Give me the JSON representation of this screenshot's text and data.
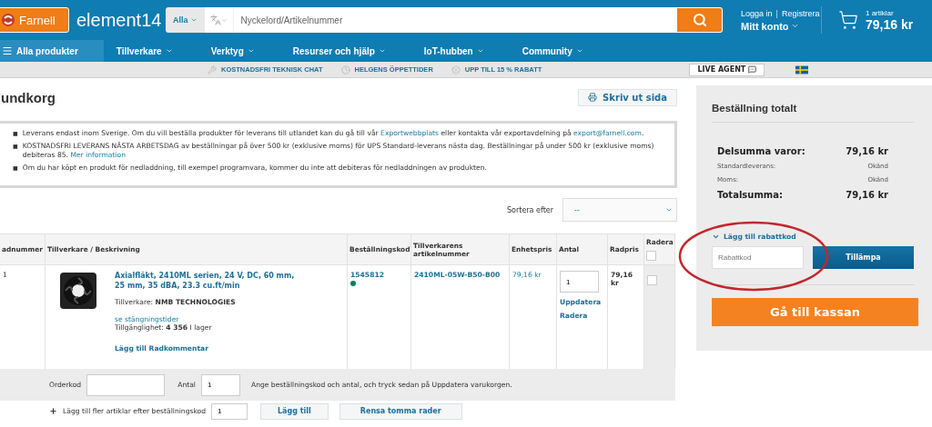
{
  "header": {
    "logo": "Farnell",
    "brand": "element14",
    "search": {
      "scope": "Alla",
      "placeholder": "Nyckelord/Artikelnummer"
    },
    "account": {
      "login": "Logga in",
      "separator": "|",
      "register": "Registrera",
      "label": "Mitt konto"
    },
    "cart": {
      "count": "1 artiklar",
      "total": "79,16 kr"
    }
  },
  "nav": [
    {
      "label": "Alla produkter",
      "selected": true,
      "menu": false
    },
    {
      "label": "Tillverkare",
      "selected": false,
      "menu": true
    },
    {
      "label": "Verktyg",
      "selected": false,
      "menu": true
    },
    {
      "label": "Resurser och hjälp",
      "selected": false,
      "menu": true
    },
    {
      "label": "IoT-hubben",
      "selected": false,
      "menu": true
    },
    {
      "label": "Community",
      "selected": false,
      "menu": true
    }
  ],
  "promo": {
    "items": [
      {
        "kind": "wrench",
        "label": "KOSTNADSFRI TEKNISK CHAT"
      },
      {
        "kind": "clock",
        "label": "HELGENS ÖPPETTIDER"
      },
      {
        "kind": "tag",
        "label": "UPP TILL 15 % RABATT"
      }
    ],
    "live_agent": "LIVE AGENT"
  },
  "page": {
    "title": "undkorg",
    "print_button": "Skriv ut sida"
  },
  "notices": [
    {
      "marker": "■",
      "parts": [
        {
          "kind": "text",
          "text": "Leverans endast inom Sverige. Om du vill beställa produkter för leverans till utlandet kan du gå till vår "
        },
        {
          "kind": "link",
          "text": "Exportwebbplats"
        },
        {
          "kind": "text",
          "text": " eller kontakta vår exportavdelning på "
        },
        {
          "kind": "link",
          "text": "export@farnell.com"
        },
        {
          "kind": "text",
          "text": "."
        }
      ]
    },
    {
      "marker": "■",
      "parts": [
        {
          "kind": "text",
          "text": "KOSTNADSFRI LEVERANS NÄSTA ARBETSDAG av beställningar på över 500 kr (exklusive moms) för UPS Standard-leverans nästa dag. Beställningar på under 500 kr (exklusive moms) debiteras 85. "
        },
        {
          "kind": "link",
          "text": "Mer information"
        }
      ]
    },
    {
      "marker": "■",
      "parts": [
        {
          "kind": "text",
          "text": "Om du har köpt en produkt för nedladdning, till exempel programvara, kommer du inte att debiteras för nedladdningen av produkten."
        }
      ]
    }
  ],
  "sort": {
    "label": "Sortera efter",
    "value": "--"
  },
  "table": {
    "columns": [
      "adnummer",
      "Tillverkare / Beskrivning",
      "Beställningskod",
      "Tillverkarens artikelnummer",
      "Enhetspris",
      "Antal",
      "Radpris",
      "Radera"
    ],
    "select_all_checked": false,
    "rows": [
      {
        "number": "1",
        "title": "Axialfläkt, 2410ML serien, 24 V, DC, 60 mm, 25 mm, 35 dBA, 23.3 cu.ft/min",
        "manufacturer_label": "Tillverkare:",
        "manufacturer": "NMB TECHNOLOGIES",
        "closing_link": "se stängningstider",
        "availability_label": "Tillgänglighet:",
        "stock": "4 356",
        "stock_suffix": "I lager",
        "comment_link": "Lägg till Radkommentar",
        "order_code": "1545812",
        "part_number": "2410ML-05W-B50-B00",
        "unit_price": "79,16 kr",
        "quantity": "1",
        "update": "Uppdatera",
        "remove": "Radera",
        "line_price": "79,16 kr",
        "checked": false
      }
    ]
  },
  "quick_add": {
    "order_label": "Orderkod",
    "qty_label": "Antal",
    "qty": "1",
    "hint": "Ange beställningskod och antal, och tryck sedan på Uppdatera varukorgen."
  },
  "add_more": {
    "label": "Lägg till fler artiklar efter beställningskod",
    "qty": "1",
    "add_button": "Lägg till",
    "clear_button": "Rensa tomma rader"
  },
  "summary": {
    "title": "Beställning totalt",
    "lines": [
      {
        "kind": "major",
        "label": "Delsumma varor:",
        "value": "79,16 kr"
      },
      {
        "kind": "minor",
        "label": "Standardleverans:",
        "value": "Okänd"
      },
      {
        "kind": "minor",
        "label": "Moms:",
        "value": "Okänd"
      },
      {
        "kind": "major",
        "label": "Totalsumma:",
        "value": "79,16 kr"
      }
    ],
    "coupon": {
      "toggle": "Lägg till rabattkod",
      "expanded": true,
      "placeholder": "Rabattkod",
      "apply": "Tillämpa"
    },
    "checkout": "Gå till kassan"
  }
}
